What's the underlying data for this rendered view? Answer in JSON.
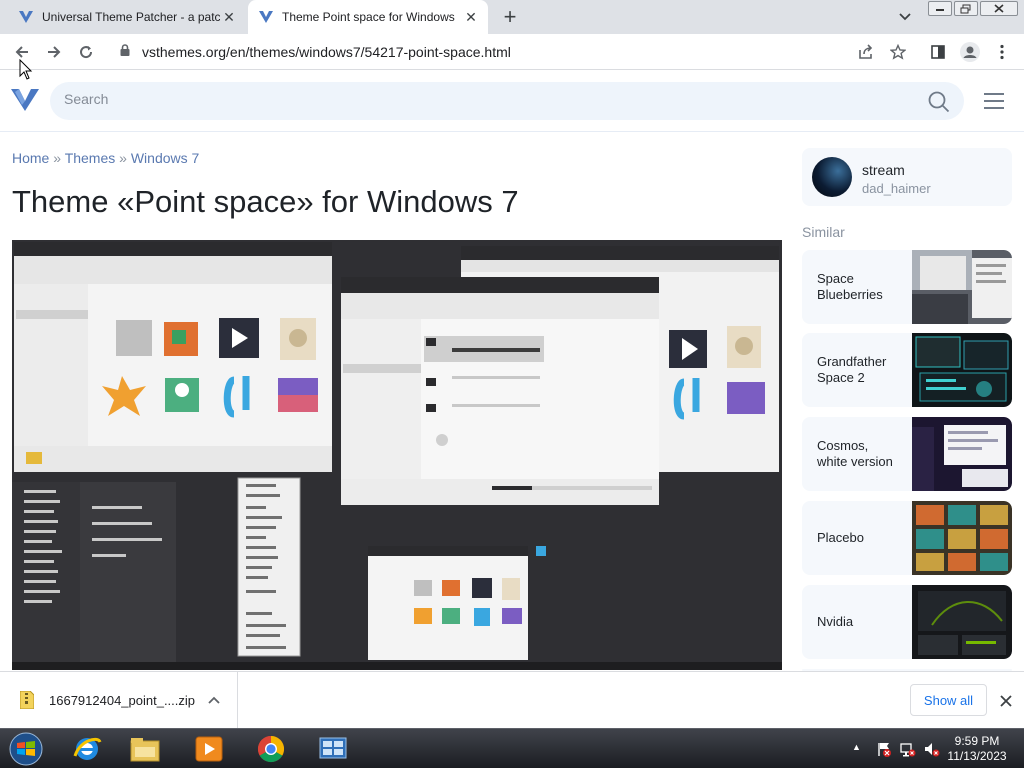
{
  "browser": {
    "tabs": [
      {
        "title": "Universal Theme Patcher - a patc",
        "active": false
      },
      {
        "title": "Theme Point space for Windows",
        "active": true
      }
    ],
    "url": "vsthemes.org/en/themes/windows7/54217-point-space.html"
  },
  "site": {
    "search_placeholder": "Search"
  },
  "breadcrumb": {
    "home": "Home",
    "sep1": "»",
    "themes": "Themes",
    "sep2": "»",
    "section": "Windows 7"
  },
  "page": {
    "title": "Theme «Point space» for Windows 7"
  },
  "sidebar": {
    "author_name": "stream",
    "author_handle": "dad_haimer",
    "similar_heading": "Similar",
    "similar": [
      {
        "line1": "Space",
        "line2": "Blueberries"
      },
      {
        "line1": "Grandfather",
        "line2": "Space 2"
      },
      {
        "line1": "Cosmos,",
        "line2": "white version"
      },
      {
        "line1": "Placebo",
        "line2": ""
      },
      {
        "line1": "Nvidia",
        "line2": ""
      }
    ]
  },
  "downloads": {
    "file_name": "1667912404_point_....zip",
    "show_all": "Show all"
  },
  "taskbar": {
    "time": "9:59 PM",
    "date": "11/13/2023"
  },
  "colors": {
    "link": "#5a79b0",
    "accent_blue": "#1a73e8",
    "search_bg": "#eef4fb",
    "screenshot_bg": "#2f2f33"
  }
}
